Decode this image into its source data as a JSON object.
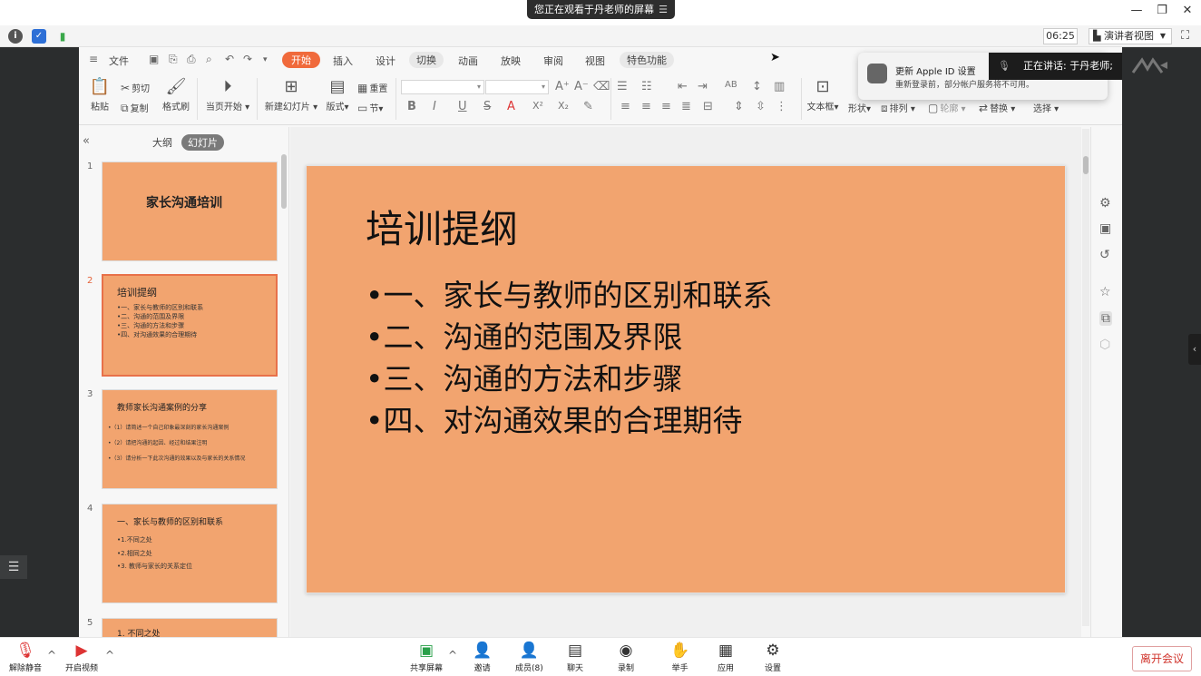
{
  "meeting": {
    "viewing_banner": "您正在观看于丹老师的屏幕",
    "timer": "06:25",
    "view_mode": "演讲者视图",
    "speaking": "正在讲话: 于丹老师;",
    "notification_title": "更新 Apple ID 设置",
    "notification_text": "重新登录前，部分帐户服务将不可用。",
    "bottom": {
      "unmute": "解除静音",
      "start_video": "开启视频",
      "share_screen": "共享屏幕",
      "invite": "邀请",
      "members": "成员(8)",
      "chat": "聊天",
      "record": "录制",
      "raise_hand": "举手",
      "apps": "应用",
      "settings": "设置",
      "leave": "离开会议"
    }
  },
  "wps": {
    "menu": {
      "file": "文件",
      "tabs": [
        "开始",
        "插入",
        "设计",
        "切换",
        "动画",
        "放映",
        "审阅",
        "视图",
        "特色功能"
      ]
    },
    "ribbon": {
      "paste": "粘贴",
      "cut": "剪切",
      "copy": "复制",
      "format_painter": "格式刷",
      "start_from_current": "当页开始",
      "new_slide": "新建幻灯片",
      "layout": "版式",
      "reset": "重置",
      "section": "节",
      "textbox": "文本框",
      "shape": "形状",
      "arrange": "排列",
      "outline": "轮廓",
      "replace": "替换",
      "select": "选择"
    },
    "panel": {
      "outline_tab": "大纲",
      "slides_tab": "幻灯片"
    },
    "slides": [
      {
        "num": "1",
        "title": "家长沟通培训"
      },
      {
        "num": "2",
        "title": "培训提纲",
        "lines": [
          "•一、家长与教师的区别和联系",
          "•二、沟通的范围及界限",
          "•三、沟通的方法和步骤",
          "•四、对沟通效果的合理期待"
        ]
      },
      {
        "num": "3",
        "title": "教师家长沟通案例的分享",
        "lines": [
          "•（1）请简述一个自己印象最深刻的家长沟通案例",
          "•（2）请把沟通的起因、经过和结果注明",
          "•（3）请分析一下此次沟通的效果以及与家长的关系情况"
        ]
      },
      {
        "num": "4",
        "title": "一、家长与教师的区别和联系",
        "lines": [
          "•1.不同之处",
          "•2.相同之处",
          "•3. 教师与家长的关系定位"
        ]
      },
      {
        "num": "5",
        "title": "1. 不同之处"
      }
    ],
    "current_slide": {
      "title": "培训提纲",
      "bullets": [
        "•一、家长与教师的区别和联系",
        "•二、沟通的范围及界限",
        "•三、沟通的方法和步骤",
        "•四、对沟通效果的合理期待"
      ]
    }
  },
  "colors": {
    "slide_bg": "#f2a46f",
    "accent": "#f06a3c",
    "leave": "#d0342c"
  }
}
